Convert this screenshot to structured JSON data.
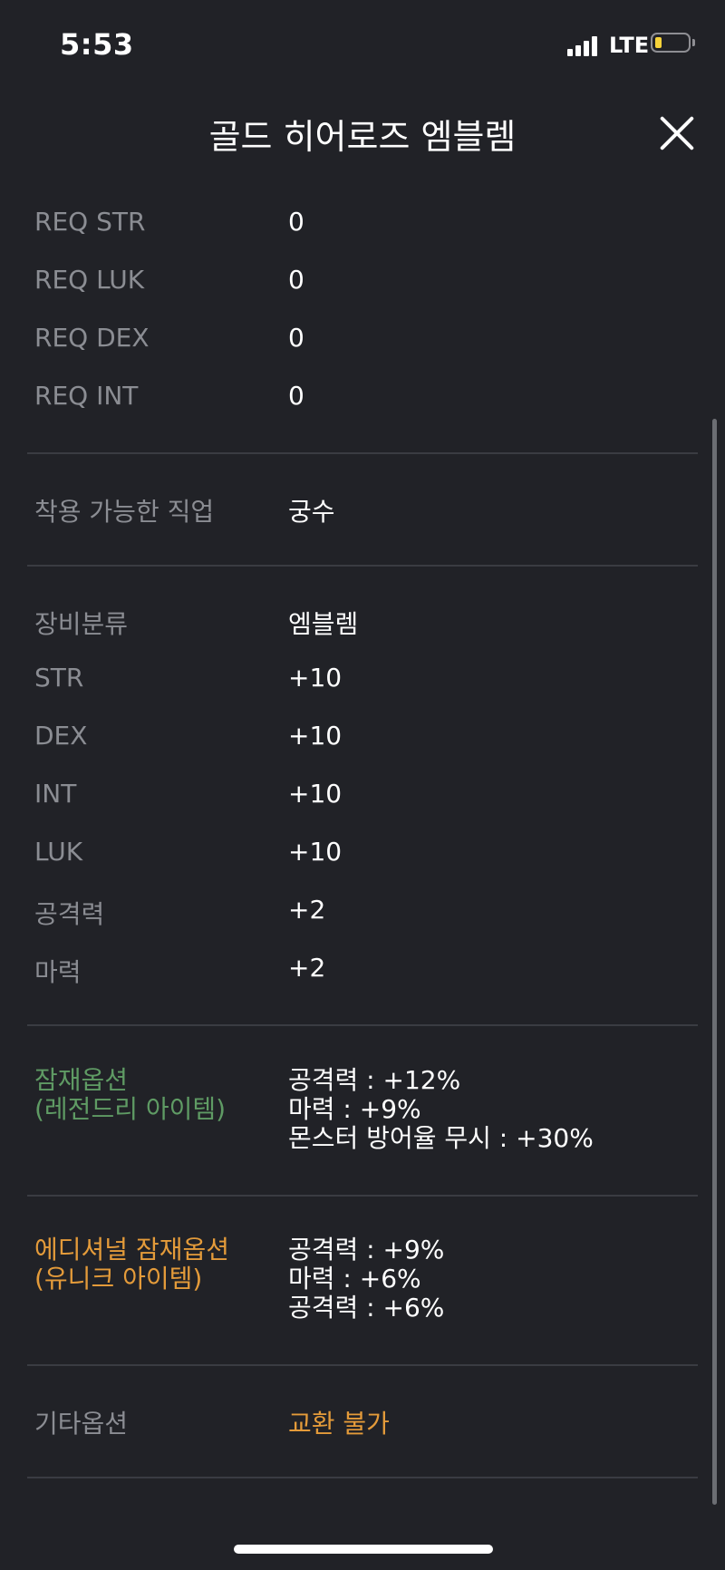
{
  "status_bar": {
    "time": "5:53",
    "network": "LTE",
    "battery_level": 0.2,
    "battery_color": "#f6d23a"
  },
  "header": {
    "title": "골드 히어로즈 엠블렘"
  },
  "requirements": [
    {
      "label": "REQ STR",
      "value": "0"
    },
    {
      "label": "REQ LUK",
      "value": "0"
    },
    {
      "label": "REQ DEX",
      "value": "0"
    },
    {
      "label": "REQ INT",
      "value": "0"
    }
  ],
  "job": {
    "label": "착용 가능한 직업",
    "value": "궁수"
  },
  "stats": [
    {
      "label": "장비분류",
      "value": "엠블렘"
    },
    {
      "label": "STR",
      "value": "+10"
    },
    {
      "label": "DEX",
      "value": "+10"
    },
    {
      "label": "INT",
      "value": "+10"
    },
    {
      "label": "LUK",
      "value": "+10"
    },
    {
      "label": "공격력",
      "value": "+2"
    },
    {
      "label": "마력",
      "value": "+2"
    }
  ],
  "potential": {
    "label_line1": "잠재옵션",
    "label_line2": "(레전드리 아이템)",
    "lines": [
      "공격력 : +12%",
      "마력 : +9%",
      "몬스터 방어율 무시 : +30%"
    ],
    "color": "#5f9b64"
  },
  "additional_potential": {
    "label_line1": "에디셔널 잠재옵션",
    "label_line2": "(유니크 아이템)",
    "lines": [
      "공격력 : +9%",
      "마력 : +6%",
      "공격력 : +6%"
    ],
    "color": "#e49b3a"
  },
  "other": {
    "label": "기타옵션",
    "value": "교환 불가",
    "value_color": "#e49b3a"
  }
}
